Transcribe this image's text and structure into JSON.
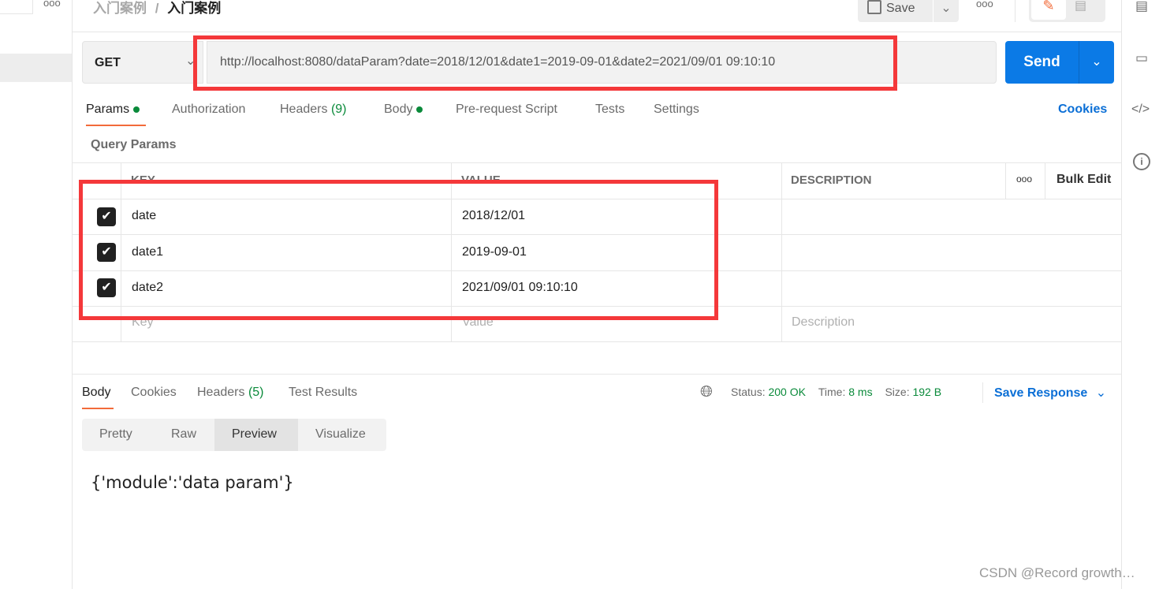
{
  "breadcrumb": {
    "parent": "入门案例",
    "current": "入门案例",
    "separator": "/"
  },
  "toolbar": {
    "save_label": "Save",
    "more": "ooo"
  },
  "sidebar": {
    "more": "ooo"
  },
  "request": {
    "method": "GET",
    "url": "http://localhost:8080/dataParam?date=2018/12/01&date1=2019-09-01&date2=2021/09/01 09:10:10",
    "send_label": "Send"
  },
  "tabs": [
    {
      "label": "Params"
    },
    {
      "label": "Authorization"
    },
    {
      "label": "Headers",
      "count": "(9)"
    },
    {
      "label": "Body"
    },
    {
      "label": "Pre-request Script"
    },
    {
      "label": "Tests"
    },
    {
      "label": "Settings"
    }
  ],
  "cookies_link": "Cookies",
  "query_params": {
    "title": "Query Params",
    "headers": [
      "KEY",
      "VALUE",
      "DESCRIPTION"
    ],
    "more": "ooo",
    "bulk_edit": "Bulk Edit",
    "rows": [
      {
        "key": "date",
        "value": "2018/12/01",
        "checked": true
      },
      {
        "key": "date1",
        "value": "2019-09-01",
        "checked": true
      },
      {
        "key": "date2",
        "value": "2021/09/01 09:10:10",
        "checked": true
      }
    ],
    "placeholders": {
      "key": "Key",
      "value": "Value",
      "description": "Description"
    }
  },
  "response": {
    "tabs": [
      {
        "label": "Body"
      },
      {
        "label": "Cookies"
      },
      {
        "label": "Headers",
        "count": "(5)"
      },
      {
        "label": "Test Results"
      }
    ],
    "status_label": "Status:",
    "status": "200 OK",
    "time_label": "Time:",
    "time": "8 ms",
    "size_label": "Size:",
    "size": "192 B",
    "save_response": "Save Response",
    "views": [
      "Pretty",
      "Raw",
      "Preview",
      "Visualize"
    ],
    "selected_view": "Preview",
    "body": "{'module':'data param'}"
  },
  "watermark": "CSDN @Record growth…",
  "colors": {
    "accent": "#f26b3a",
    "send": "#0b7ae6",
    "link": "#0b6fd6",
    "status_green": "#0a8a3a",
    "annotation": "#f4383a"
  }
}
